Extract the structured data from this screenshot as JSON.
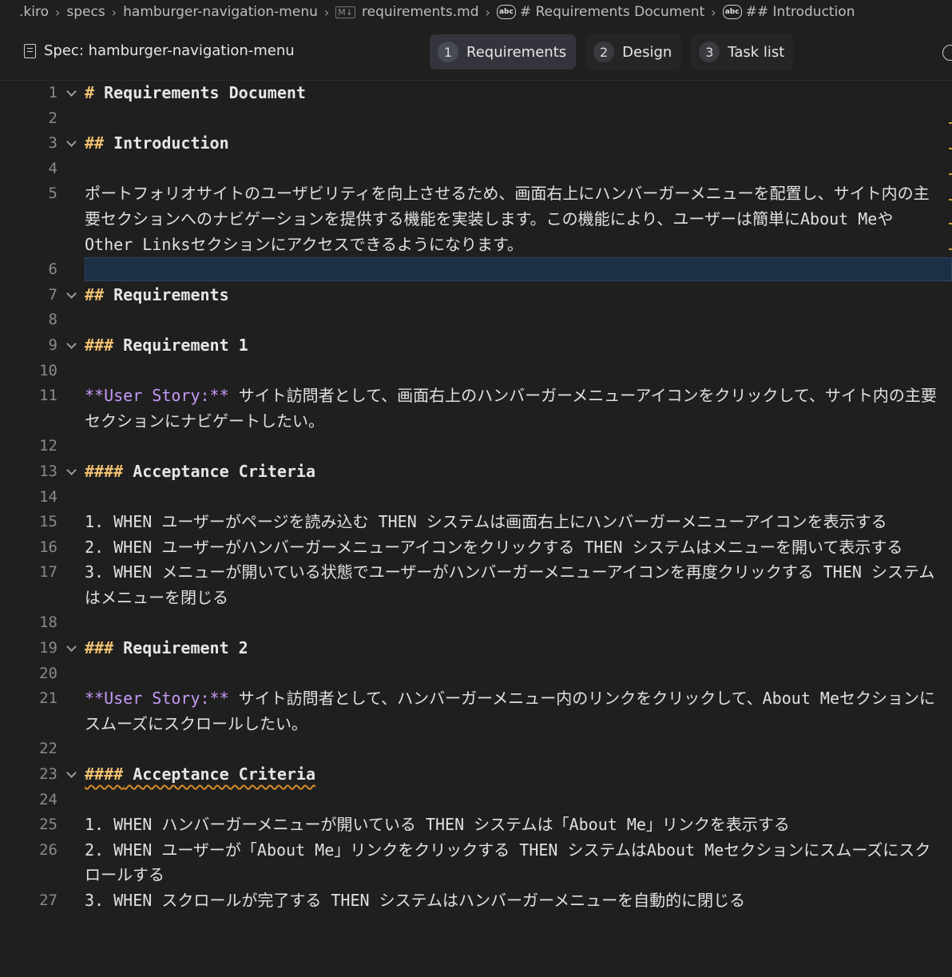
{
  "breadcrumb": [
    ".kiro",
    "specs",
    "hamburger-navigation-menu",
    "requirements.md",
    "# Requirements Document",
    "## Introduction"
  ],
  "specbar": {
    "title": "Spec: hamburger-navigation-menu",
    "tabs": [
      {
        "num": "1",
        "label": "Requirements",
        "active": true
      },
      {
        "num": "2",
        "label": "Design",
        "active": false
      },
      {
        "num": "3",
        "label": "Task list",
        "active": false
      }
    ]
  },
  "lines": [
    {
      "n": "1",
      "fold": true,
      "hash": "#",
      "text": " Requirements Document"
    },
    {
      "n": "2"
    },
    {
      "n": "3",
      "fold": true,
      "hash": "##",
      "text": " Introduction"
    },
    {
      "n": "4"
    },
    {
      "n": "5",
      "text": "ポートフォリオサイトのユーザビリティを向上させるため、画面右上にハンバーガーメニューを配置し、サイト内の主要セクションへのナビゲーションを提供する機能を実装します。この機能により、ユーザーは簡単にAbout MeやOther Linksセクションにアクセスできるようになります。"
    },
    {
      "n": "6",
      "current": true
    },
    {
      "n": "7",
      "fold": true,
      "hash": "##",
      "text": " Requirements"
    },
    {
      "n": "8"
    },
    {
      "n": "9",
      "fold": true,
      "hash": "###",
      "text": " Requirement 1"
    },
    {
      "n": "10"
    },
    {
      "n": "11",
      "us": "**User Story:**",
      "text": " サイト訪問者として、画面右上のハンバーガーメニューアイコンをクリックして、サイト内の主要セクションにナビゲートしたい。"
    },
    {
      "n": "12"
    },
    {
      "n": "13",
      "fold": true,
      "hash": "####",
      "text": " Acceptance Criteria"
    },
    {
      "n": "14"
    },
    {
      "n": "15",
      "text": "1. WHEN ユーザーがページを読み込む THEN システムは画面右上にハンバーガーメニューアイコンを表示する"
    },
    {
      "n": "16",
      "text": "2. WHEN ユーザーがハンバーガーメニューアイコンをクリックする THEN システムはメニューを開いて表示する"
    },
    {
      "n": "17",
      "text": "3. WHEN メニューが開いている状態でユーザーがハンバーガーメニューアイコンを再度クリックする THEN システムはメニューを閉じる"
    },
    {
      "n": "18"
    },
    {
      "n": "19",
      "fold": true,
      "hash": "###",
      "text": " Requirement 2"
    },
    {
      "n": "20"
    },
    {
      "n": "21",
      "us": "**User Story:**",
      "text": " サイト訪問者として、ハンバーガーメニュー内のリンクをクリックして、About Meセクションにスムーズにスクロールしたい。"
    },
    {
      "n": "22"
    },
    {
      "n": "23",
      "fold": true,
      "hash": "####",
      "text": " Acceptance Criteria",
      "squiggle": true
    },
    {
      "n": "24"
    },
    {
      "n": "25",
      "text": "1. WHEN ハンバーガーメニューが開いている THEN システムは「About Me」リンクを表示する"
    },
    {
      "n": "26",
      "text": "2. WHEN ユーザーが「About Me」リンクをクリックする THEN システムはAbout Meセクションにスムーズにスクロールする"
    },
    {
      "n": "27",
      "text": "3. WHEN スクロールが完了する THEN システムはハンバーガーメニューを自動的に閉じる"
    }
  ]
}
